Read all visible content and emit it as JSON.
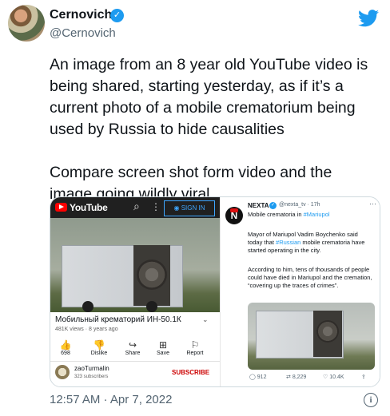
{
  "author": {
    "name": "Cernovich",
    "handle": "@Cernovich",
    "verified_glyph": "✓"
  },
  "tweet": {
    "paragraphs": [
      "An image from an 8 year old YouTube video is being shared, starting yesterday, as if it’s a current photo of a mobile crematorium being used by Russia to hide causalities",
      "Compare screen shot form video and the image going wildly viral."
    ],
    "timestamp": "12:57 AM · Apr 7, 2022"
  },
  "youtube": {
    "logo_text": "YouTube",
    "search_icon": "⌕",
    "menu_icon": "⋮",
    "signin_label": "SIGN IN",
    "video_title": "Мобильный крематорий ИН-50.1К",
    "meta": "481K views · 8 years ago",
    "actions": [
      {
        "icon": "👍",
        "label": "698"
      },
      {
        "icon": "👎",
        "label": "Dislike"
      },
      {
        "icon": "↪",
        "label": "Share"
      },
      {
        "icon": "⊞",
        "label": "Save"
      },
      {
        "icon": "⚐",
        "label": "Report"
      }
    ],
    "channel_name": "zaoTurmalin",
    "subscribers": "323 subscribers",
    "subscribe_label": "SUBSCRIBE"
  },
  "nexta": {
    "logo_letter": "N",
    "name": "NEXTA",
    "handle": "@nexta_tv · 17h",
    "headline": "Mobile crematoria in",
    "headline_tag": "#Mariupol",
    "para1_a": "Mayor of Mariupol Vadim Boychenko said today that",
    "para1_tag": "#Russian",
    "para1_b": "mobile crematoria have started operating in the city.",
    "para2": "According to him, tens of thousands of people could have died in Mariupol and the cremation, “covering up the traces of crimes”.",
    "stats": {
      "replies": "912",
      "retweets": "8,229",
      "likes": "10.4K"
    }
  },
  "colors": {
    "accent": "#1d9bf0",
    "youtube_red": "#ff0000",
    "text": "#0f1419",
    "muted": "#536471"
  }
}
